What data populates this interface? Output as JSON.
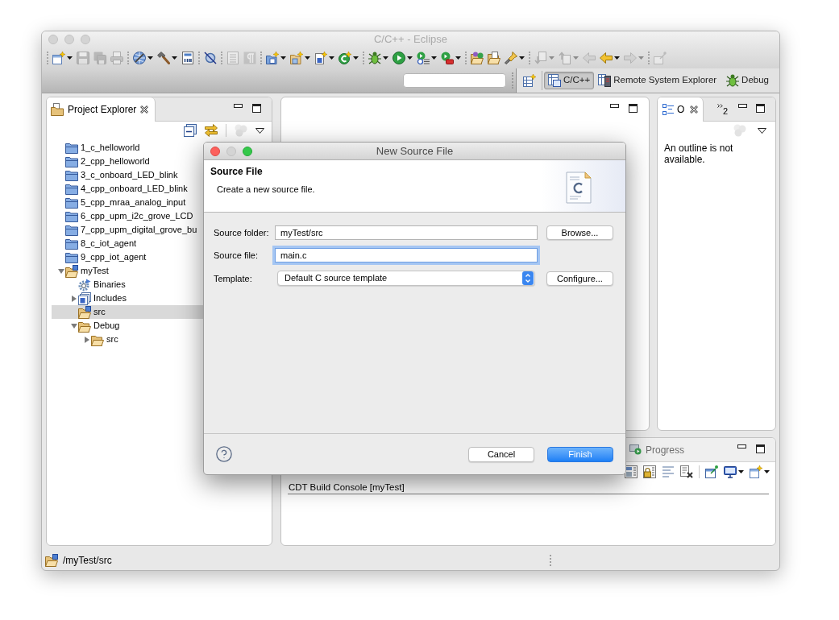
{
  "window": {
    "title": "C/C++ - Eclipse",
    "active": false
  },
  "toolbar": [
    [
      {
        "kind": "new-window",
        "disabled": false,
        "dropdown": true
      },
      {
        "kind": "save",
        "disabled": true
      },
      {
        "kind": "save-all",
        "disabled": true
      },
      {
        "kind": "print",
        "disabled": true
      }
    ],
    [
      {
        "kind": "build-settings",
        "disabled": false,
        "dropdown": true
      },
      {
        "kind": "build",
        "disabled": false,
        "dropdown": true
      },
      {
        "kind": "binary",
        "disabled": false
      }
    ],
    [
      {
        "kind": "skip-breakpoints",
        "disabled": false
      }
    ],
    [
      {
        "kind": "block",
        "disabled": true
      },
      {
        "kind": "whitespace",
        "disabled": true
      }
    ],
    [
      {
        "kind": "new-project",
        "disabled": false,
        "dropdown": true
      },
      {
        "kind": "new-folder",
        "disabled": false,
        "dropdown": true
      },
      {
        "kind": "new-file",
        "disabled": false,
        "dropdown": true
      },
      {
        "kind": "new-class",
        "disabled": false,
        "dropdown": true
      }
    ],
    [
      {
        "kind": "debug",
        "disabled": false,
        "dropdown": true
      },
      {
        "kind": "run",
        "disabled": false,
        "dropdown": true
      },
      {
        "kind": "coverage",
        "disabled": false,
        "dropdown": true
      },
      {
        "kind": "external-tools",
        "disabled": false,
        "dropdown": true
      }
    ],
    [
      {
        "kind": "open-type",
        "disabled": false
      },
      {
        "kind": "open-element",
        "disabled": false
      },
      {
        "kind": "search",
        "disabled": false,
        "dropdown": true
      }
    ],
    [
      {
        "kind": "next-annotation",
        "disabled": true,
        "dropdown": true
      },
      {
        "kind": "prev-annotation",
        "disabled": true,
        "dropdown": true
      },
      {
        "kind": "back",
        "disabled": true
      },
      {
        "kind": "back",
        "disabled": false,
        "dropdown": true
      },
      {
        "kind": "forward",
        "disabled": true,
        "dropdown": true
      }
    ],
    [
      {
        "kind": "pin",
        "disabled": true
      }
    ]
  ],
  "perspectives": [
    {
      "label": "C/C++",
      "kind": "c-cpp",
      "selected": true
    },
    {
      "label": "Remote System Explorer",
      "kind": "remote",
      "selected": false
    },
    {
      "label": "Debug",
      "kind": "debug",
      "selected": false
    }
  ],
  "project_explorer": {
    "tab": {
      "label": "Project Explorer",
      "selected": true
    },
    "view_toolbar": [
      [
        {
          "kind": "collapse-all",
          "disabled": false
        },
        {
          "kind": "link",
          "disabled": false
        }
      ],
      [
        {
          "kind": "filters",
          "disabled": true
        },
        {
          "kind": "view-menu",
          "disabled": false
        }
      ]
    ],
    "tree": [
      {
        "label": "1_c_helloworld",
        "kind": "closed-project",
        "selected": false
      },
      {
        "label": "2_cpp_helloworld",
        "kind": "closed-project",
        "selected": false
      },
      {
        "label": "3_c_onboard_LED_blink",
        "kind": "closed-project",
        "selected": false
      },
      {
        "label": "4_cpp_onboard_LED_blink",
        "kind": "closed-project",
        "selected": false
      },
      {
        "label": "5_cpp_mraa_analog_input",
        "kind": "closed-project",
        "selected": false
      },
      {
        "label": "6_cpp_upm_i2c_grove_LCD",
        "kind": "closed-project",
        "selected": false
      },
      {
        "label": "7_cpp_upm_digital_grove_bu",
        "kind": "closed-project",
        "selected": false
      },
      {
        "label": "8_c_iot_agent",
        "kind": "closed-project",
        "selected": false
      },
      {
        "label": "9_cpp_iot_agent",
        "kind": "closed-project",
        "selected": false
      },
      {
        "label": "myTest",
        "kind": "project",
        "selected": false,
        "expanded": true,
        "children": [
          {
            "label": "Binaries",
            "kind": "binaries",
            "selected": false
          },
          {
            "label": "Includes",
            "kind": "includes",
            "selected": false,
            "expanded": false
          },
          {
            "label": "src",
            "kind": "source-folder",
            "selected": true
          },
          {
            "label": "Debug",
            "kind": "folder",
            "selected": false,
            "expanded": true,
            "children": [
              {
                "label": "src",
                "kind": "folder",
                "selected": false,
                "expanded": false
              }
            ]
          }
        ]
      }
    ]
  },
  "outline": {
    "tab": {
      "label": "O",
      "selected": true
    },
    "overflow_count": "2",
    "view_toolbar": [
      [
        {
          "kind": "filters",
          "disabled": true
        },
        {
          "kind": "view-menu",
          "disabled": false
        }
      ]
    ],
    "message": "An outline is not available."
  },
  "bottom_panel": {
    "tabs": [
      {
        "label": "Progress",
        "selected": false
      }
    ],
    "view_toolbar": [
      [
        {
          "kind": "console-grid",
          "disabled": false
        },
        {
          "kind": "scroll-lock",
          "disabled": false
        },
        {
          "kind": "word-wrap",
          "disabled": false
        },
        {
          "kind": "remove-launch",
          "disabled": false
        }
      ],
      [
        {
          "kind": "pin-console",
          "disabled": false
        },
        {
          "kind": "display",
          "disabled": false,
          "dropdown": true
        },
        {
          "kind": "new-console",
          "disabled": false,
          "dropdown": true
        }
      ]
    ],
    "console_title": "CDT Build Console [myTest]"
  },
  "status_bar": {
    "path": "/myTest/src"
  },
  "dialog": {
    "title": "New Source File",
    "active": true,
    "minimizable": false,
    "heading": "Source File",
    "description": "Create a new source file.",
    "fields": [
      {
        "label": "Source folder:",
        "kind": "text",
        "value": "myTest/src",
        "focused": false,
        "button": "Browse..."
      },
      {
        "label": "Source file:",
        "kind": "text",
        "value": "main.c",
        "focused": true
      },
      {
        "label": "Template:",
        "kind": "select",
        "value": "Default C source template",
        "focused": false,
        "button": "Configure..."
      }
    ],
    "buttons": [
      {
        "label": "Cancel",
        "default": false
      },
      {
        "label": "Finish",
        "default": true
      }
    ]
  }
}
